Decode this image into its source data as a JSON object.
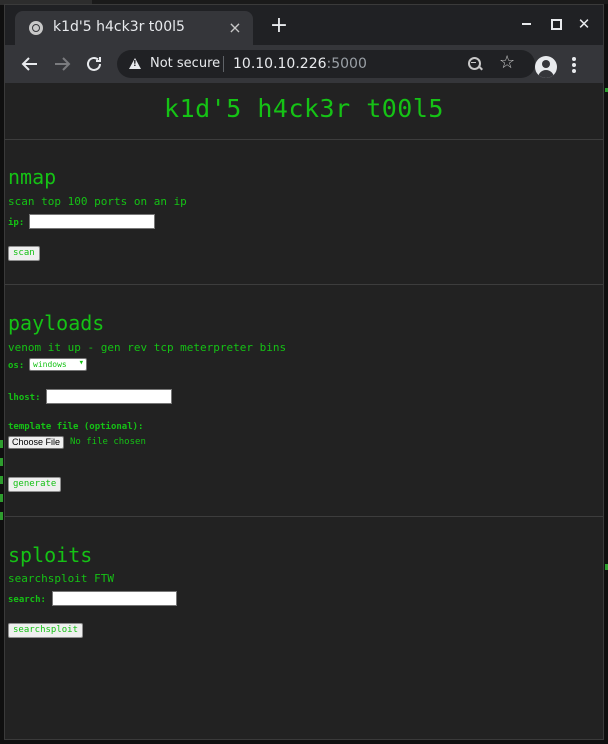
{
  "browser": {
    "tab_title": "k1d'5 h4ck3r t00l5",
    "tab_close": "×",
    "new_tab": "+",
    "close_window": "✕",
    "security_label": "Not secure",
    "url_host": "10.10.10.226",
    "url_port": ":5000",
    "icons": [
      "globe-icon",
      "warning-icon",
      "zoom-icon",
      "star-icon",
      "profile-icon",
      "menu-icon"
    ]
  },
  "page": {
    "title": "k1d'5 h4ck3r t00l5",
    "colors": {
      "text": "#15c215",
      "background": "#222222"
    },
    "nmap": {
      "heading": "nmap",
      "description": "scan top 100 ports on an ip",
      "ip_label": "ip:",
      "ip_value": "",
      "scan_button": "scan"
    },
    "payloads": {
      "heading": "payloads",
      "description": "venom it up - gen rev tcp meterpreter bins",
      "os_label": "os:",
      "os_selected": "windows",
      "lhost_label": "lhost:",
      "lhost_value": "",
      "template_label": "template file (optional):",
      "choose_file_button": "Choose File",
      "file_status": "No file chosen",
      "generate_button": "generate"
    },
    "sploits": {
      "heading": "sploits",
      "description": "searchsploit FTW",
      "search_label": "search:",
      "search_value": "",
      "searchsploit_button": "searchsploit"
    }
  }
}
